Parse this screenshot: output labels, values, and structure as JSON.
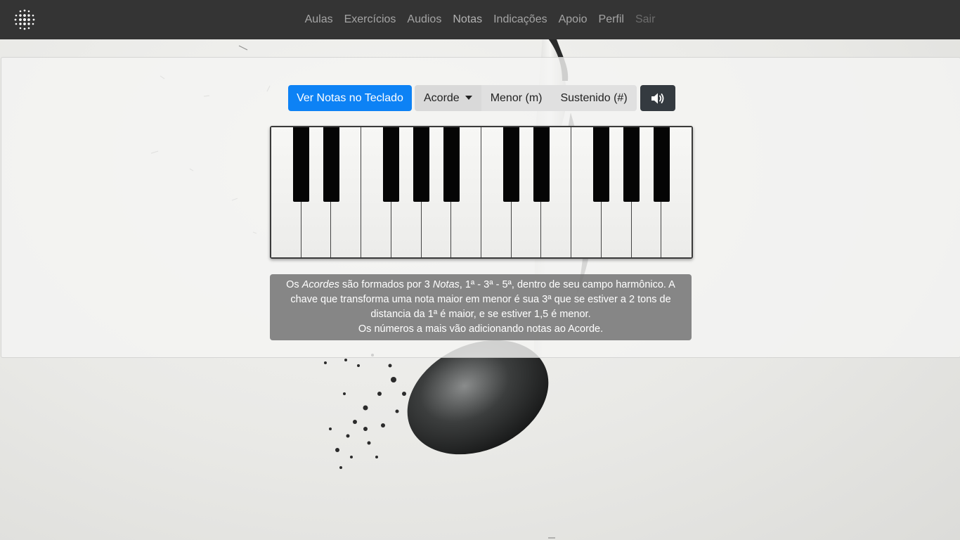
{
  "navbar": {
    "logo": "dot-grid-logo",
    "links": [
      {
        "label": "Aulas"
      },
      {
        "label": "Exercícios"
      },
      {
        "label": "Audios"
      },
      {
        "label": "Notas"
      },
      {
        "label": "Indicações"
      },
      {
        "label": "Apoio"
      },
      {
        "label": "Perfil"
      },
      {
        "label": "Sair"
      }
    ]
  },
  "toolbar": {
    "show_notes_label": "Ver Notas no Teclado",
    "chord_label": "Acorde",
    "minor_label": "Menor (m)",
    "sharp_label": "Sustenido (#)",
    "sound_icon": "volume-icon"
  },
  "keyboard": {
    "white_key_count": 14,
    "black_key_count": 10
  },
  "info": {
    "line1_pre": "Os ",
    "acordes": "Acordes",
    "line1_mid": " são formados por 3 ",
    "notas": "Notas",
    "line1_post": ", 1ª - 3ª - 5ª, dentro de seu campo harmônico. A chave que transforma uma nota maior em menor é sua 3ª que se estiver a 2 tons de distancia da 1ª é maior, e se estiver 1,5 é menor.",
    "line2": "Os números a mais vão adicionando notas ao Acorde."
  },
  "colors": {
    "navbar": "#343434",
    "primary": "#0d82f5",
    "dark_button": "#343a40"
  }
}
